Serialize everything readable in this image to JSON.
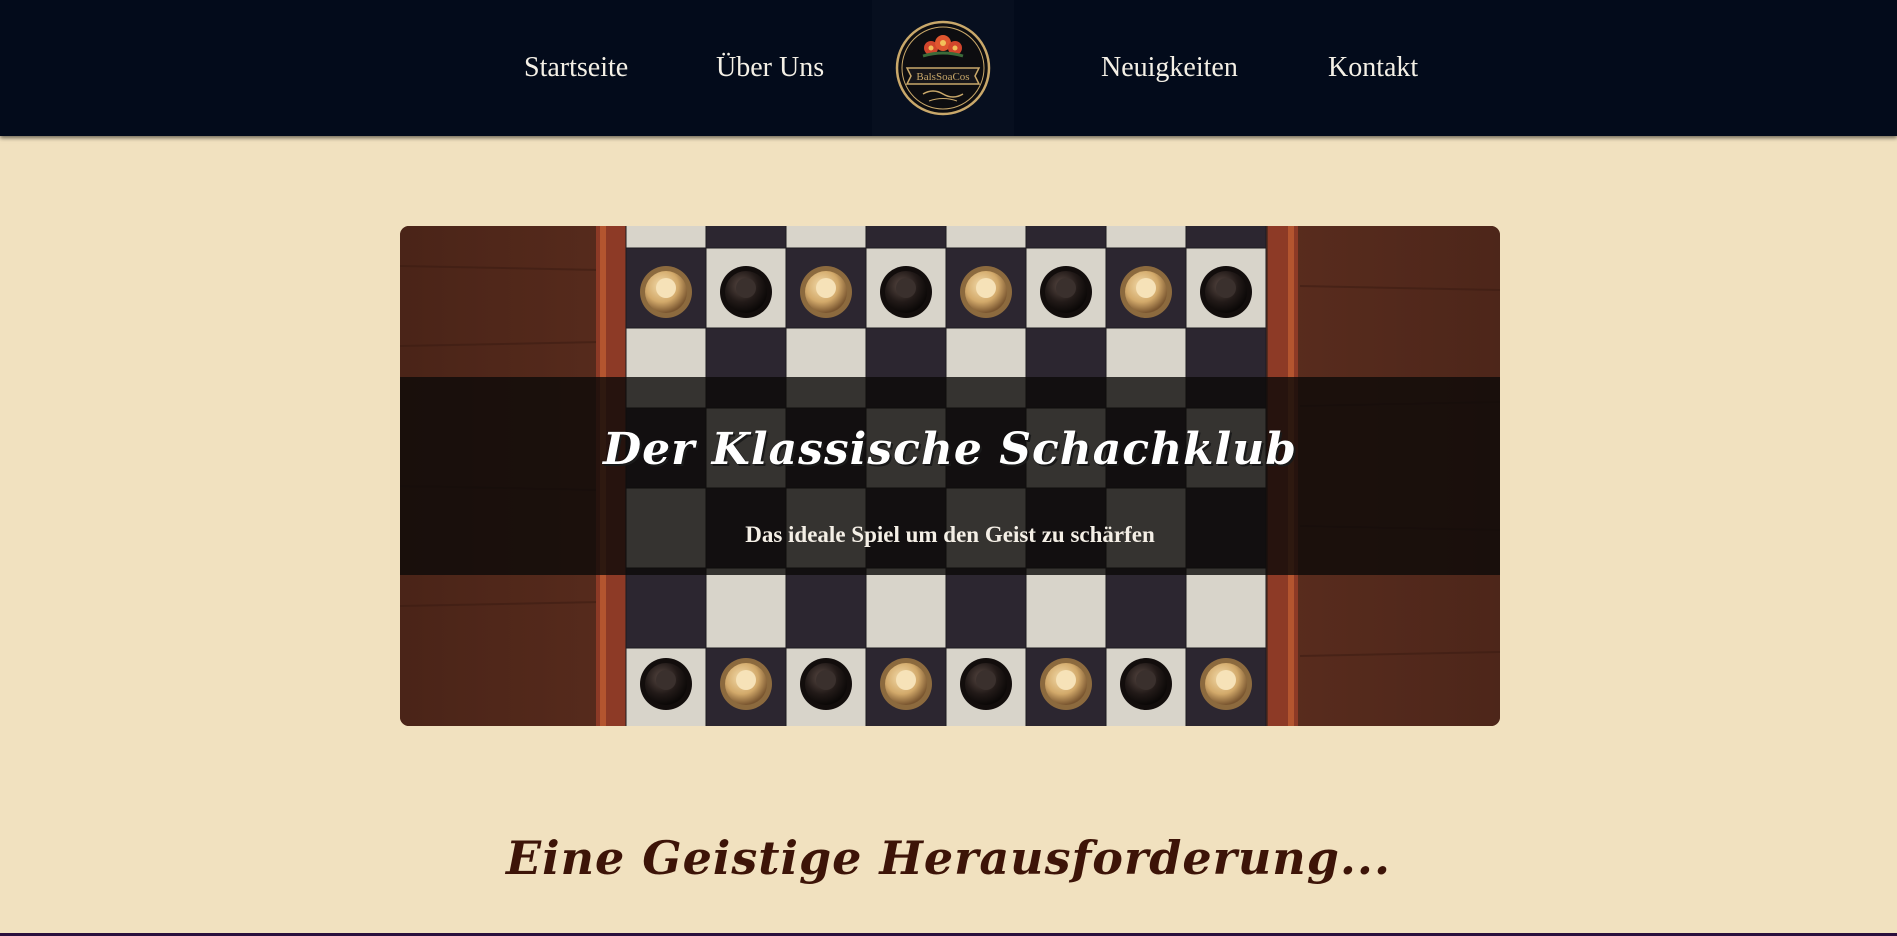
{
  "nav": {
    "items": [
      {
        "label": "Startseite"
      },
      {
        "label": "Über Uns"
      },
      {
        "label": "Neuigkeiten"
      },
      {
        "label": "Kontakt"
      }
    ],
    "logo_text": "BalsSoaCos"
  },
  "hero": {
    "title": "Der Klassische Schachklub",
    "subtitle": "Das ideale Spiel um den Geist zu schärfen"
  },
  "section": {
    "heading": "Eine Geistige Herausforderung..."
  },
  "colors": {
    "nav_background": "#030b1b",
    "page_background": "#f1e1bf",
    "heading_color": "#3d1408",
    "logo_gold": "#c9a86a"
  }
}
